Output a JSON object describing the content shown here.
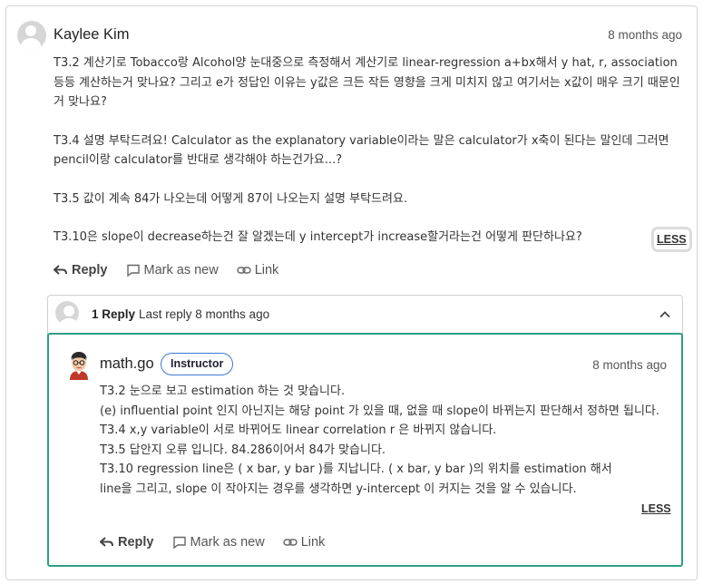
{
  "post": {
    "author": "Kaylee Kim",
    "time": "8 months ago",
    "paragraphs": [
      "T3.2 계산기로 Tobacco랑 Alcohol양 눈대중으로 측정해서 계산기로 linear-regression a+bx해서 y hat, r, association 등등 계산하는거 맞나요? 그리고 e가 정답인 이유는 y값은 크든 작든 영향을 크게 미치지 않고 여기서는 x값이 매우 크기 때문인거 맞나요?",
      "T3.4 설명 부탁드려요! Calculator as the explanatory variable이라는 말은 calculator가 x축이 된다는 말인데 그러면 pencil이랑 calculator를 반대로 생각해야 하는건가요...?",
      "T3.5 값이 계속 84가 나오는데 어떻게 87이 나오는지 설명 부탁드려요.",
      "T3.10은 slope이 decrease하는건 잘 알겠는데 y intercept가 increase할거라는건 어떻게 판단하나요?"
    ],
    "less_label": "LESS",
    "actions": {
      "reply": "Reply",
      "mark": "Mark as new",
      "link": "Link"
    }
  },
  "thread": {
    "reply_count": "1 Reply",
    "last_reply": "Last reply 8 months ago"
  },
  "reply": {
    "author": "math.go",
    "badge": "Instructor",
    "time": "8 months ago",
    "lines": [
      "T3.2 눈으로 보고 estimation 하는 것 맞습니다.",
      "(e) influential point 인지 아닌지는 해당 point 가 있을 때, 없을 때 slope이 바뀌는지 판단해서 정하면 됩니다.",
      "T3.4 x,y variable이 서로 바뀌어도 linear correlation r 은 바뀌지 않습니다.",
      "T3.5 답안지 오류 입니다. 84.286이어서 84가 맞습니다.",
      "T3.10 regression line은 ( x bar, y bar )를 지납니다. ( x bar, y bar )의 위치를 estimation 해서 line을 그리고, slope 이 작아지는 경우를 생각하면 y-intercept 이 커지는 것을 알 수 있습니다."
    ],
    "less_label": "LESS",
    "actions": {
      "reply": "Reply",
      "mark": "Mark as new",
      "link": "Link"
    }
  }
}
